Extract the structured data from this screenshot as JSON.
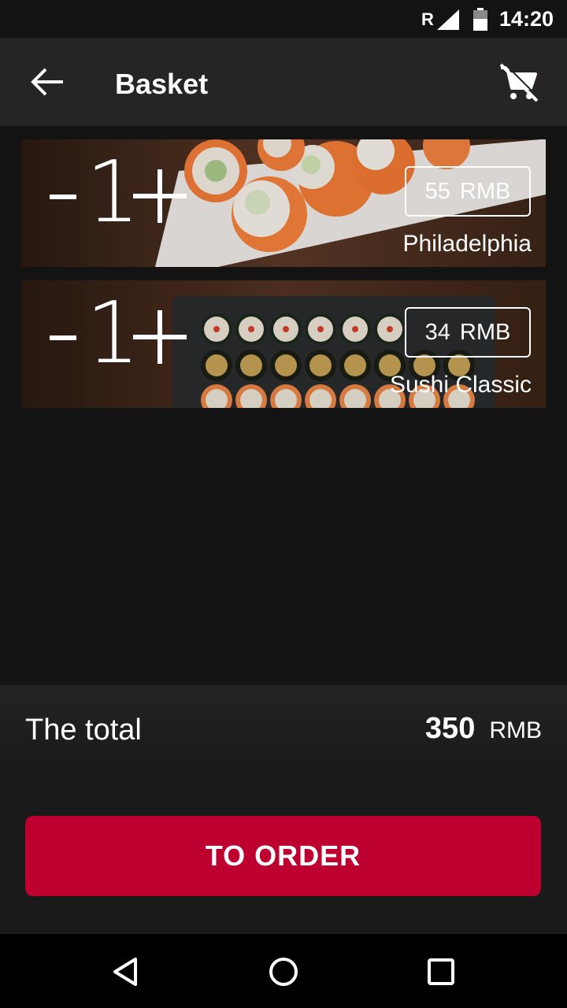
{
  "status_bar": {
    "roaming": "R",
    "time": "14:20",
    "icons": [
      "signal-icon",
      "battery-icon"
    ]
  },
  "app_bar": {
    "title": "Basket",
    "back_icon": "arrow-left-icon",
    "action_icon": "remove-cart-icon"
  },
  "items": [
    {
      "qty_minus": "-",
      "quantity": "1",
      "qty_plus": "+",
      "price": "55",
      "currency": "RMB",
      "name": "Philadelphia"
    },
    {
      "qty_minus": "-",
      "quantity": "1",
      "qty_plus": "+",
      "price": "34",
      "currency": "RMB",
      "name": "Sushi Classic"
    }
  ],
  "total": {
    "label": "The total",
    "amount": "350",
    "currency": "RMB"
  },
  "order_button": {
    "label": "TO ORDER"
  },
  "nav_bar": {
    "icons": [
      "back-triangle-icon",
      "home-circle-icon",
      "recents-square-icon"
    ]
  },
  "colors": {
    "accent": "#bd0030",
    "app_bar": "#272425",
    "background": "#141314"
  }
}
